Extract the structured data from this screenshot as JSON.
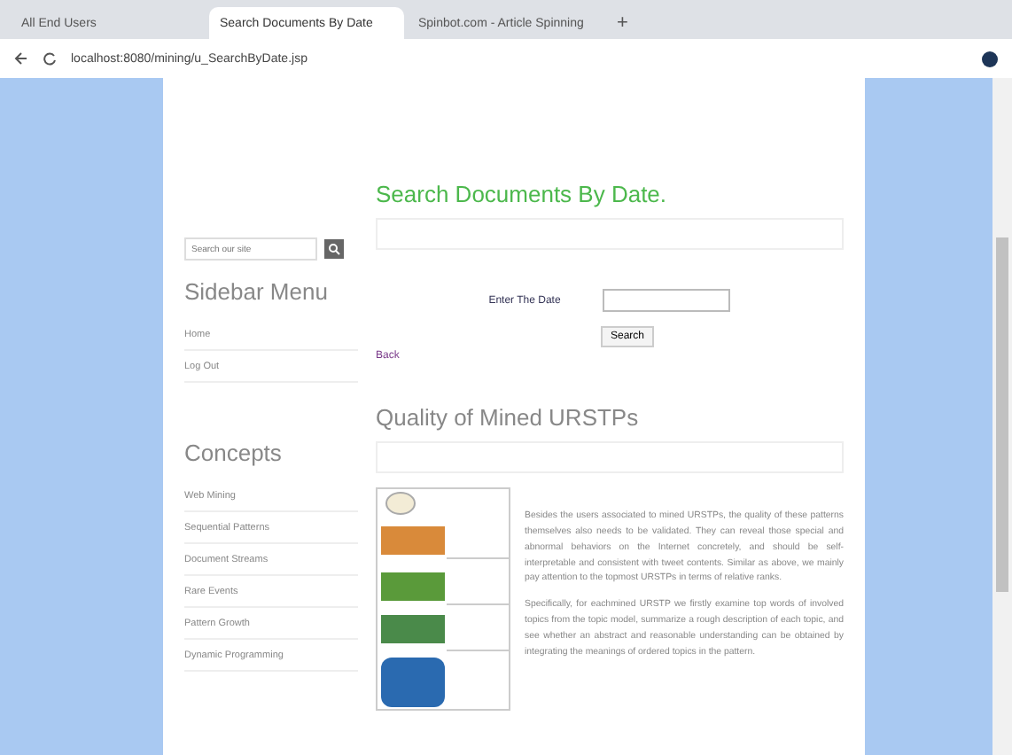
{
  "browser": {
    "tabs": [
      {
        "title": "All End Users",
        "selected": false
      },
      {
        "title": "Search Documents By Date",
        "selected": true
      },
      {
        "title": "Spinbot.com - Article Spinning",
        "selected": false
      }
    ],
    "new_tab": "+",
    "url": "localhost:8080/mining/u_SearchByDate.jsp"
  },
  "sidebar": {
    "search": {
      "placeholder": "Search our site"
    },
    "menu_title": "Sidebar Menu",
    "menu_items": [
      "Home",
      "Log Out"
    ],
    "concepts_title": "Concepts",
    "concepts": [
      "Web Mining",
      "Sequential Patterns",
      "Document Streams",
      "Rare Events",
      "Pattern Growth",
      "Dynamic Programming"
    ]
  },
  "main": {
    "title": "Search Documents By Date.",
    "date_label": "Enter The Date",
    "search_button": "Search",
    "back_link": "Back",
    "section_title": "Quality of Mined URSTPs",
    "paragraphs": [
      "Besides the users associated to mined URSTPs, the quality of these patterns themselves also needs to be validated. They can reveal those special and abnormal behaviors on the Internet concretely, and should be self-interpretable and consistent with tweet contents. Similar as above, we mainly pay attention to the topmost URSTPs in terms of relative ranks.",
      "Specifically, for eachmined URSTP we firstly examine top words of involved topics from the topic model, summarize a rough description of each topic, and see whether an abstract and reasonable understanding can be obtained by integrating the meanings of ordered topics in the pattern."
    ]
  }
}
